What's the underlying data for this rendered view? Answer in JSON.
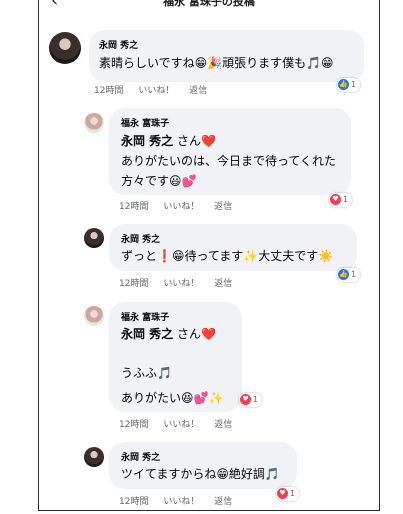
{
  "header": {
    "title": "福永 富珠子の投稿",
    "back_icon": "chevron-left-icon",
    "more_icon": "more-dots-icon",
    "back_glyph": "‹",
    "more_glyph": "•••"
  },
  "actions": {
    "like": "いいね！",
    "reply": "返信"
  },
  "comments": [
    {
      "author": "永岡 秀之",
      "lines": [
        "素晴らしいですね😁🎉頑張ります僕も🎵😁"
      ],
      "time": "12時間",
      "reaction": {
        "type": "like",
        "count": "1"
      }
    },
    {
      "author": "福永 富珠子",
      "mention": "永岡 秀之",
      "mention_suffix": "さん❤️",
      "lines": [
        "ありがたいのは、今日まで待ってくれた",
        "方々です😃💕"
      ],
      "time": "12時間",
      "reaction": {
        "type": "love",
        "count": "1"
      }
    },
    {
      "author": "永岡 秀之",
      "lines": [
        "ずっと❗😁待ってます✨大丈夫です☀️"
      ],
      "time": "12時間",
      "reaction": {
        "type": "like",
        "count": "1"
      }
    },
    {
      "author": "福永 富珠子",
      "mention": "永岡 秀之",
      "mention_suffix": "さん❤️",
      "lines": [
        "うふふ🎵",
        "ありがたい😆💕✨"
      ],
      "time": "12時間",
      "reaction": {
        "type": "love",
        "count": "1"
      }
    },
    {
      "author": "永岡 秀之",
      "lines": [
        "ツイてますからね😁絶好調🎵"
      ],
      "time": "12時間",
      "reaction": {
        "type": "love",
        "count": "1"
      }
    }
  ],
  "colors": {
    "bubble": "#f0f2f5",
    "meta": "#65676b",
    "like": "#1877f2",
    "love": "#f33e58"
  }
}
